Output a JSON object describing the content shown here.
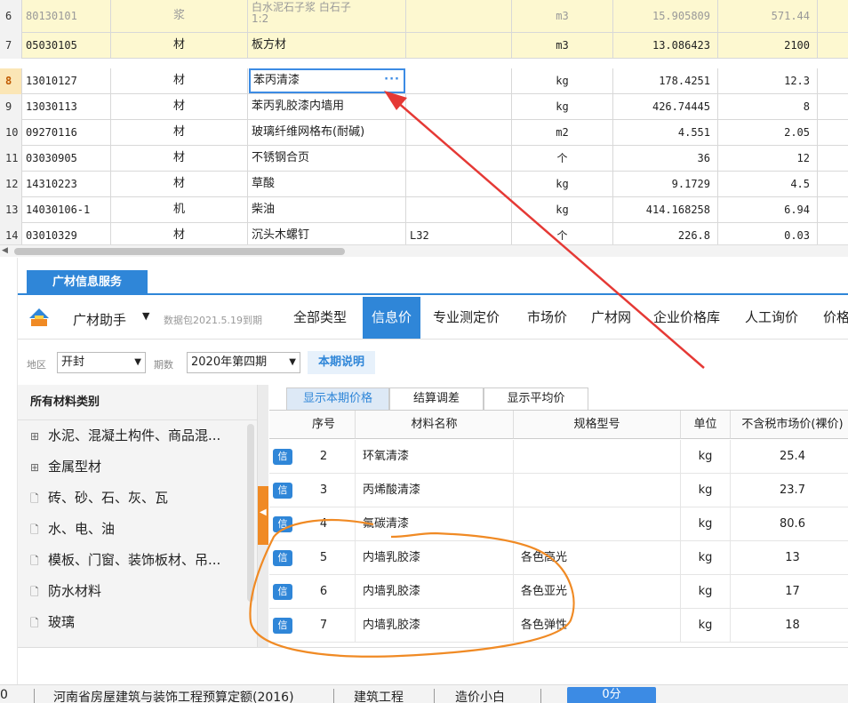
{
  "top_grid": {
    "rows": [
      {
        "idx": "6",
        "code": "80130101",
        "type": "浆",
        "name_line1": "白水泥石子浆 白石子",
        "name_line2": "1:2",
        "spec": "",
        "unit": "m3",
        "qty": "15.905809",
        "price": "571.44"
      },
      {
        "idx": "7",
        "code": "05030105",
        "type": "材",
        "name": "板方材",
        "spec": "",
        "unit": "m3",
        "qty": "13.086423",
        "price": "2100"
      },
      {
        "idx": "8",
        "code": "13010127",
        "type": "材",
        "name": "苯丙清漆",
        "spec": "",
        "unit": "kg",
        "qty": "178.4251",
        "price": "12.3"
      },
      {
        "idx": "9",
        "code": "13030113",
        "type": "材",
        "name": "苯丙乳胶漆内墙用",
        "spec": "",
        "unit": "kg",
        "qty": "426.74445",
        "price": "8"
      },
      {
        "idx": "10",
        "code": "09270116",
        "type": "材",
        "name": "玻璃纤维网格布(耐碱)",
        "spec": "",
        "unit": "m2",
        "qty": "4.551",
        "price": "2.05"
      },
      {
        "idx": "11",
        "code": "03030905",
        "type": "材",
        "name": "不锈钢合页",
        "spec": "",
        "unit": "个",
        "qty": "36",
        "price": "12"
      },
      {
        "idx": "12",
        "code": "14310223",
        "type": "材",
        "name": "草酸",
        "spec": "",
        "unit": "kg",
        "qty": "9.1729",
        "price": "4.5"
      },
      {
        "idx": "13",
        "code": "14030106-1",
        "type": "机",
        "name": "柴油",
        "spec": "",
        "unit": "kg",
        "qty": "414.168258",
        "price": "6.94"
      },
      {
        "idx": "14",
        "code": "03010329",
        "type": "材",
        "name": "沉头木螺钉",
        "spec": "L32",
        "unit": "个",
        "qty": "226.8",
        "price": "0.03"
      }
    ],
    "edit_dots": "···"
  },
  "service_tab": "广材信息服务",
  "nav": {
    "assistant": "广材助手",
    "caret": "▼",
    "data_pack": "数据包2021.5.19到期",
    "tabs": [
      "全部类型",
      "信息价",
      "专业测定价",
      "市场价",
      "广材网",
      "企业价格库",
      "人工询价",
      "价格"
    ]
  },
  "filter": {
    "region_label": "地区",
    "region_value": "开封",
    "period_label": "期数",
    "period_value": "2020年第四期",
    "note_button": "本期说明"
  },
  "tree": {
    "title": "所有材料类别",
    "items": [
      {
        "icon": "⊞",
        "label": "水泥、混凝土构件、商品混..."
      },
      {
        "icon": "⊞",
        "label": "金属型材"
      },
      {
        "icon": "🗋",
        "label": "砖、砂、石、灰、瓦"
      },
      {
        "icon": "🗋",
        "label": "水、电、油"
      },
      {
        "icon": "🗋",
        "label": "模板、门窗、装饰板材、吊..."
      },
      {
        "icon": "🗋",
        "label": "防水材料"
      },
      {
        "icon": "🗋",
        "label": "玻璃"
      }
    ]
  },
  "price_tabs": [
    "显示本期价格",
    "结算调差",
    "显示平均价"
  ],
  "price_table": {
    "headers": [
      "序号",
      "材料名称",
      "规格型号",
      "单位",
      "不含税市场价(裸价)"
    ],
    "badge": "信",
    "rows": [
      {
        "seq": "2",
        "name": "环氧清漆",
        "spec": "",
        "unit": "kg",
        "price": "25.4"
      },
      {
        "seq": "3",
        "name": "丙烯酸清漆",
        "spec": "",
        "unit": "kg",
        "price": "23.7"
      },
      {
        "seq": "4",
        "name": "氟碳清漆",
        "spec": "",
        "unit": "kg",
        "price": "80.6"
      },
      {
        "seq": "5",
        "name": "内墙乳胶漆",
        "spec": "各色高光",
        "unit": "kg",
        "price": "13"
      },
      {
        "seq": "6",
        "name": "内墙乳胶漆",
        "spec": "各色亚光",
        "unit": "kg",
        "price": "17"
      },
      {
        "seq": "7",
        "name": "内墙乳胶漆",
        "spec": "各色弹性",
        "unit": "kg",
        "price": "18"
      }
    ]
  },
  "status_bar": {
    "left_fragment": "0",
    "quota": "河南省房屋建筑与装饰工程预算定额(2016)",
    "category": "建筑工程",
    "user": "造价小白",
    "score": "0分"
  },
  "colors": {
    "accent": "#2f86d8",
    "annotation_orange": "#f08a24",
    "arrow_red": "#e53935",
    "row_highlight": "#fdf8d0"
  }
}
